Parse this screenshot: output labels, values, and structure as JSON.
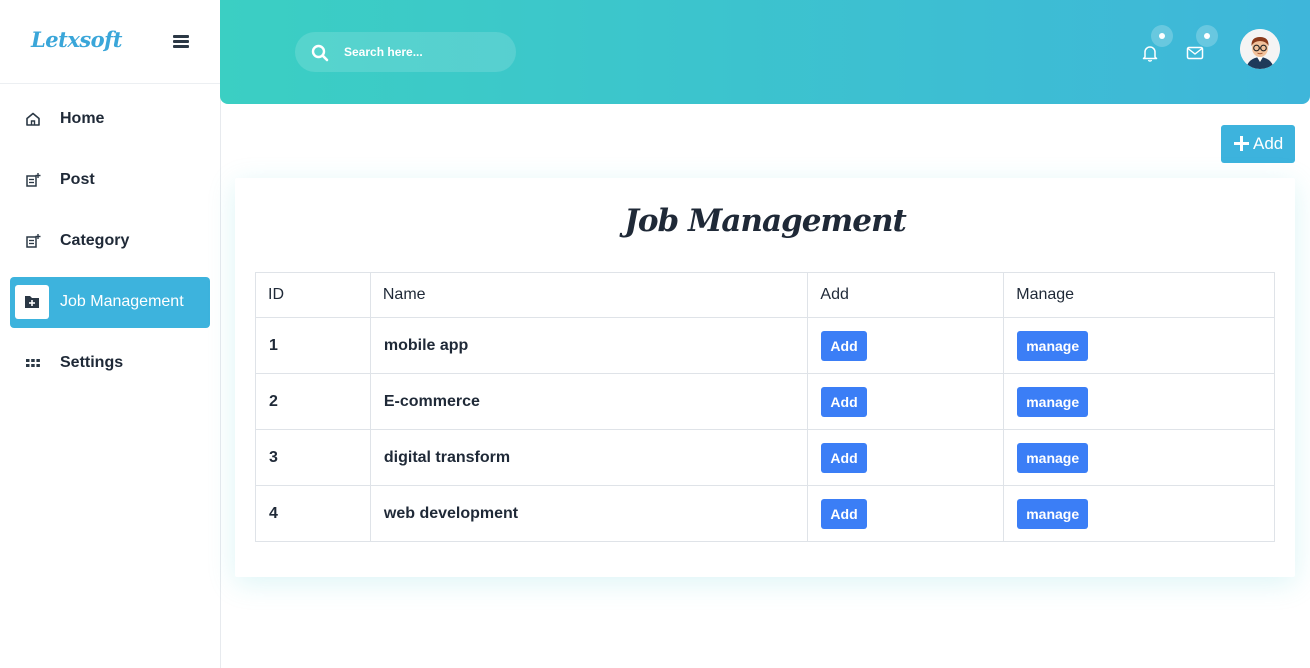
{
  "app": {
    "name": "Letxsoft"
  },
  "sidebar": {
    "items": [
      {
        "label": "Home",
        "icon": "home-icon",
        "active": false
      },
      {
        "label": "Post",
        "icon": "post-icon",
        "active": false
      },
      {
        "label": "Category",
        "icon": "category-icon",
        "active": false
      },
      {
        "label": "Job Management",
        "icon": "folder-plus-icon",
        "active": true
      },
      {
        "label": "Settings",
        "icon": "grid-icon",
        "active": false
      }
    ]
  },
  "header": {
    "search_placeholder": "Search here...",
    "notifications_icon": "bell-icon",
    "messages_icon": "mail-icon",
    "avatar_icon": "user-avatar"
  },
  "toolbar": {
    "add_label": "Add"
  },
  "main": {
    "title": "Job Management",
    "table": {
      "columns": [
        "ID",
        "Name",
        "Add",
        "Manage"
      ],
      "rows": [
        {
          "id": "1",
          "name": "mobile app",
          "add_label": "Add",
          "manage_label": "manage"
        },
        {
          "id": "2",
          "name": "E-commerce",
          "add_label": "Add",
          "manage_label": "manage"
        },
        {
          "id": "3",
          "name": "digital transform",
          "add_label": "Add",
          "manage_label": "manage"
        },
        {
          "id": "4",
          "name": "web development",
          "add_label": "Add",
          "manage_label": "manage"
        }
      ]
    }
  },
  "colors": {
    "accent": "#3db3dd",
    "header_gradient_start": "#3bcfc3",
    "header_gradient_end": "#3eb6da",
    "button_primary": "#3b7ef6"
  }
}
